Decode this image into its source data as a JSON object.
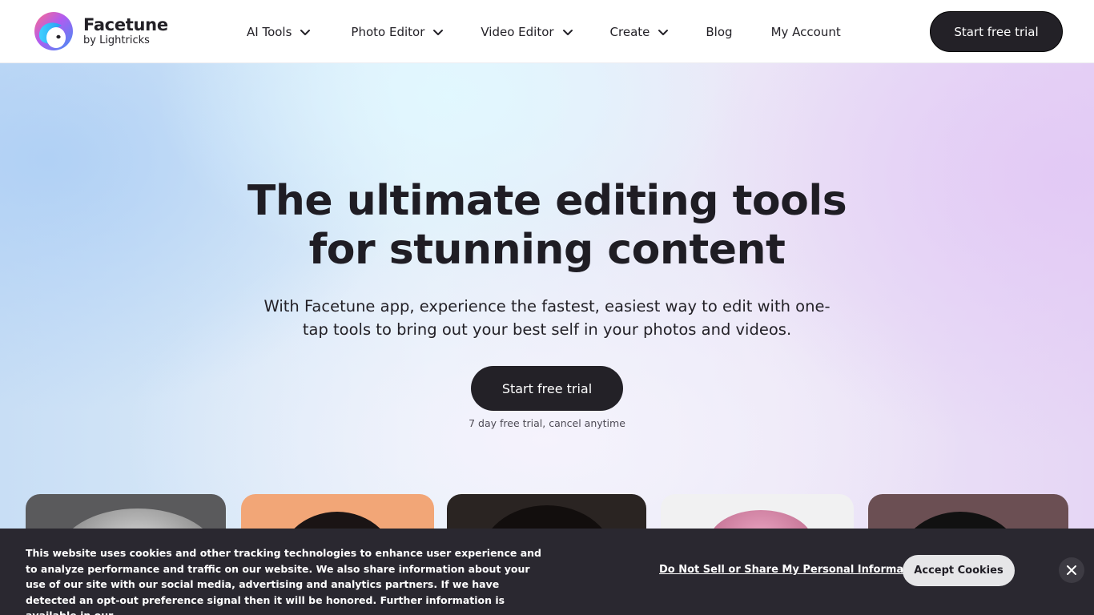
{
  "brand": {
    "name": "Facetune",
    "byline": "by Lightricks"
  },
  "nav": {
    "items": [
      {
        "label": "AI Tools",
        "dropdown": true
      },
      {
        "label": "Photo Editor",
        "dropdown": true
      },
      {
        "label": "Video Editor",
        "dropdown": true
      },
      {
        "label": "Create",
        "dropdown": true
      },
      {
        "label": "Blog",
        "dropdown": false
      },
      {
        "label": "My Account",
        "dropdown": false
      }
    ],
    "cta_label": "Start free trial"
  },
  "hero": {
    "title_line1": "The ultimate editing tools",
    "title_line2": "for stunning content",
    "subtitle": "With Facetune app, experience the fastest, easiest way to edit with one-tap tools to bring out your best self in your photos and videos.",
    "cta_label": "Start free trial",
    "note": "7 day free trial, cancel anytime"
  },
  "cookie_banner": {
    "text": "This website uses cookies and other tracking technologies to enhance user experience and to analyze performance and traffic on our website. We also share information about your use of our site with our social media, advertising and analytics partners. If we have detected an opt-out preference signal then it will be honored. Further information is available in our",
    "privacy_link": "Do Not Sell or Share My Personal Information",
    "accept_label": "Accept Cookies",
    "close_icon": "close-icon"
  },
  "colors": {
    "dark": "#232127",
    "banner_bg": "#2a2830",
    "accept_bg": "#e6e6e8"
  },
  "icons": [
    "facetune-logo-icon",
    "chevron-down-icon",
    "close-icon"
  ]
}
